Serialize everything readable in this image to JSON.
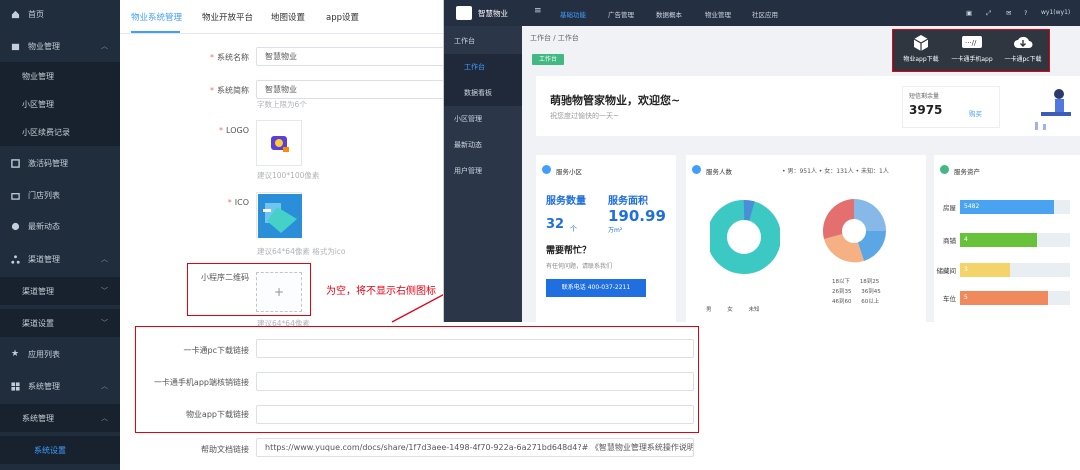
{
  "sidebar": {
    "items": [
      {
        "label": "首页",
        "icon": "home-icon"
      },
      {
        "label": "物业管理",
        "icon": "property-icon"
      },
      {
        "label": "物业管理"
      },
      {
        "label": "小区管理"
      },
      {
        "label": "小区续费记录"
      },
      {
        "label": "激活码管理",
        "icon": "code-icon"
      },
      {
        "label": "门店列表",
        "icon": "store-icon"
      },
      {
        "label": "最新动态",
        "icon": "news-icon"
      },
      {
        "label": "渠道管理",
        "icon": "channel-icon"
      },
      {
        "label": "渠道管理"
      },
      {
        "label": "渠道设置"
      },
      {
        "label": "应用列表",
        "icon": "star-icon"
      },
      {
        "label": "系统管理",
        "icon": "grid-icon"
      },
      {
        "label": "系统管理"
      },
      {
        "label": "系统设置"
      }
    ]
  },
  "tabs": [
    "物业系统管理",
    "物业开放平台",
    "地图设置",
    "app设置"
  ],
  "form": {
    "system_name_label": "系统名称",
    "system_name_value": "智慧物业",
    "system_short_label": "系统简称",
    "system_short_value": "智慧物业",
    "system_short_hint": "字数上限为6个",
    "logo_label": "LOGO",
    "logo_hint": "建议100*100像素",
    "ico_label": "ICO",
    "ico_hint": "建议64*64像素 格式为ico",
    "miniapp_qr_label": "小程序二维码",
    "miniapp_qr_hint": "建议64*64像素",
    "upload_plus": "+",
    "pc_download_label": "一卡通pc下载链接",
    "mobile_download_label": "一卡通手机app端核销链接",
    "property_app_label": "物业app下载链接",
    "help_doc_label": "帮助文档链接",
    "help_doc_value": "https://www.yuque.com/docs/share/1f7d3aee-1498-4f70-922a-6a271bd648d4?# 《智慧物业管理系统操作说明书"
  },
  "annotation": {
    "note": "为空，将不显示右侧图标",
    "color": "#e60012"
  },
  "preview": {
    "brand": "智慧物业",
    "nav": [
      "基础功能",
      "广告管理",
      "数据概本",
      "物业管理",
      "社区应用"
    ],
    "user": "wy1(wy1)",
    "side": [
      "工作台",
      "工作台",
      "数据看板",
      "小区管理",
      "最新动态",
      "用户管理"
    ],
    "breadcrumb": "工作台 / 工作台",
    "tag": "工作台",
    "welcome_title": "萌驰物管家物业，欢迎您~",
    "welcome_sub": "祝您度过愉快的一天~",
    "sms_label": "短信剩余量",
    "sms_value": "3975",
    "sms_buy": "购买",
    "card1_title": "服务小区",
    "card1_count_label": "服务数量",
    "card1_count_value": "32",
    "card1_count_unit": "个",
    "card1_area_label": "服务面积",
    "card1_area_value": "190.99",
    "card1_area_unit": "万m²",
    "card1_help": "需要帮忙？",
    "card1_help_sub": "有任何问题，请联系我们",
    "card1_phone_btn": "联系电话 400-037-2211",
    "card2_title": "服务人数",
    "card2_legend": "• 男：951人  • 女：131人  • 未知：1人",
    "card2_age_legend": [
      "18以下",
      "18到25",
      "26到35",
      "36到45",
      "46到60",
      "60以上"
    ],
    "card2_gender_legend": [
      "男",
      "女",
      "未知"
    ],
    "card3_title": "服务资产",
    "assets": [
      {
        "name": "房屋",
        "value": "5482"
      },
      {
        "name": "商铺",
        "value": "4"
      },
      {
        "name": "储藏间",
        "value": "3"
      },
      {
        "name": "车位",
        "value": "5"
      }
    ],
    "downloads": [
      "物业app下载",
      "一卡通手机app",
      "一卡通pc下载"
    ],
    "download_pc_icon": "cloud-download-icon"
  }
}
